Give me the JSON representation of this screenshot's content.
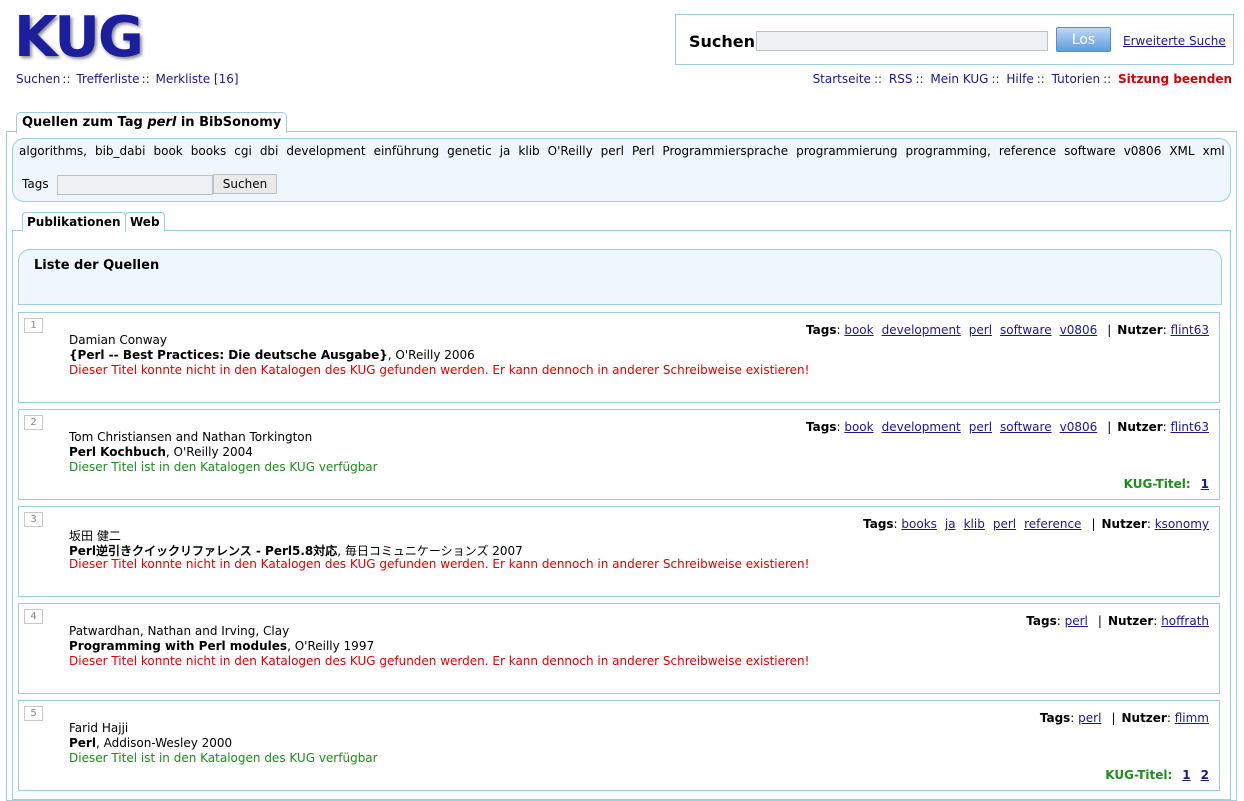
{
  "logo": "KUG",
  "leftnav": {
    "search": "Suchen",
    "results": "Trefferliste",
    "watchlist": "Merkliste [16]"
  },
  "search": {
    "label": "Suchen",
    "button": "Los",
    "advanced": "Erweiterte Suche",
    "value": ""
  },
  "rightnav": {
    "home": "Startseite",
    "rss": "RSS",
    "mykug": "Mein KUG",
    "help": "Hilfe",
    "tutorials": "Tutorien",
    "logout": "Sitzung beenden"
  },
  "section": {
    "title_prefix": "Quellen zum Tag ",
    "tag": "perl",
    "title_suffix": " in BibSonomy"
  },
  "tagcloud": {
    "tags": [
      "algorithms,",
      "bib_dabi",
      "book",
      "books",
      "cgi",
      "dbi",
      "development",
      "einführung",
      "genetic",
      "ja",
      "klib",
      "O'Reilly",
      "perl",
      "Perl",
      "Programmiersprache",
      "programmierung",
      "programming,",
      "reference",
      "software",
      "v0806",
      "XML",
      "xml"
    ],
    "input_label": "Tags",
    "button": "Suchen"
  },
  "tabs": {
    "publications": "Publikationen",
    "web": "Web"
  },
  "list": {
    "title": "Liste der Quellen",
    "tags_label": "Tags",
    "user_label": "Nutzer",
    "kug_label": "KUG-Titel:",
    "entries": [
      {
        "num": "1",
        "author": "Damian Conway",
        "title": "{Perl -- Best Practices: Die deutsche Ausgabe}",
        "pub": ", O'Reilly 2006",
        "status": "Dieser Titel konnte nicht in den Katalogen des KUG gefunden werden. Er kann dennoch in anderer Schreibweise existieren!",
        "found": false,
        "tags": [
          "book",
          "development",
          "perl",
          "software",
          "v0806"
        ],
        "user": "flint63",
        "kug": []
      },
      {
        "num": "2",
        "author": "Tom Christiansen and Nathan Torkington",
        "title": "Perl Kochbuch",
        "pub": ", O'Reilly 2004",
        "status": "Dieser Titel ist in den Katalogen des KUG verfügbar",
        "found": true,
        "tags": [
          "book",
          "development",
          "perl",
          "software",
          "v0806"
        ],
        "user": "flint63",
        "kug": [
          "1"
        ]
      },
      {
        "num": "3",
        "author": "坂田 健二",
        "title": "Perl逆引きクイックリファレンス - Perl5.8対応",
        "pub": ", 毎日コミュニケーションズ 2007",
        "status": "Dieser Titel konnte nicht in den Katalogen des KUG gefunden werden. Er kann dennoch in anderer Schreibweise existieren!",
        "found": false,
        "tags": [
          "books",
          "ja",
          "klib",
          "perl",
          "reference"
        ],
        "user": "ksonomy",
        "kug": []
      },
      {
        "num": "4",
        "author": "Patwardhan, Nathan and Irving, Clay",
        "title": "Programming with Perl modules",
        "pub": ", O'Reilly 1997",
        "status": "Dieser Titel konnte nicht in den Katalogen des KUG gefunden werden. Er kann dennoch in anderer Schreibweise existieren!",
        "found": false,
        "tags": [
          "perl"
        ],
        "user": "hoffrath",
        "kug": []
      },
      {
        "num": "5",
        "author": "Farid Hajji",
        "title": "Perl",
        "pub": ", Addison-Wesley 2000",
        "status": "Dieser Titel ist in den Katalogen des KUG verfügbar",
        "found": true,
        "tags": [
          "perl"
        ],
        "user": "flimm",
        "kug": [
          "1",
          "2"
        ]
      }
    ]
  }
}
